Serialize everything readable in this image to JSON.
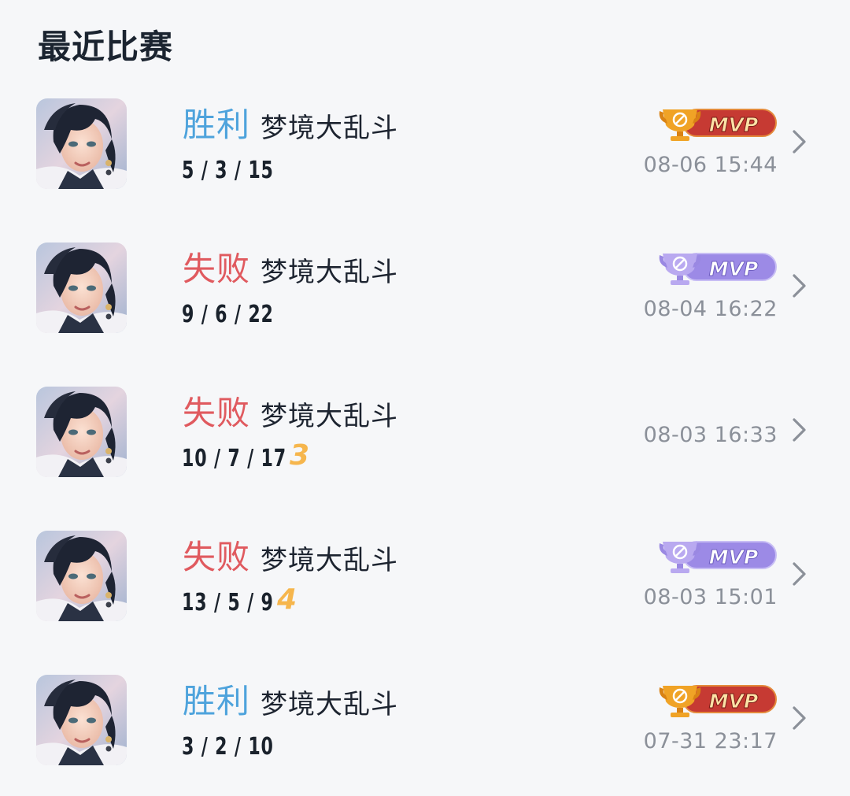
{
  "header": {
    "title": "最近比赛"
  },
  "colors": {
    "win": "#4ea3dc",
    "loss": "#e05a5f",
    "streak": "#f6b64d",
    "mvp_gold": "#c63a33",
    "mvp_purple": "#9c8ae6",
    "time_gray": "#8b9099"
  },
  "matches": [
    {
      "result": "胜利",
      "result_type": "win",
      "mode": "梦境大乱斗",
      "kda": "5 / 3 / 15",
      "streak": "",
      "mvp": "MVP",
      "mvp_style": "gold",
      "time": "08-06 15:44",
      "avatar_icon": "hero-avatar"
    },
    {
      "result": "失败",
      "result_type": "loss",
      "mode": "梦境大乱斗",
      "kda": "9 / 6 / 22",
      "streak": "",
      "mvp": "MVP",
      "mvp_style": "purple",
      "time": "08-04 16:22",
      "avatar_icon": "hero-avatar"
    },
    {
      "result": "失败",
      "result_type": "loss",
      "mode": "梦境大乱斗",
      "kda": "10 / 7 / 17",
      "streak": "3",
      "mvp": "",
      "mvp_style": "none",
      "time": "08-03 16:33",
      "avatar_icon": "hero-avatar"
    },
    {
      "result": "失败",
      "result_type": "loss",
      "mode": "梦境大乱斗",
      "kda": "13 / 5 / 9",
      "streak": "4",
      "mvp": "MVP",
      "mvp_style": "purple",
      "time": "08-03 15:01",
      "avatar_icon": "hero-avatar"
    },
    {
      "result": "胜利",
      "result_type": "win",
      "mode": "梦境大乱斗",
      "kda": "3 / 2 / 10",
      "streak": "",
      "mvp": "MVP",
      "mvp_style": "gold",
      "time": "07-31 23:17",
      "avatar_icon": "hero-avatar"
    }
  ]
}
